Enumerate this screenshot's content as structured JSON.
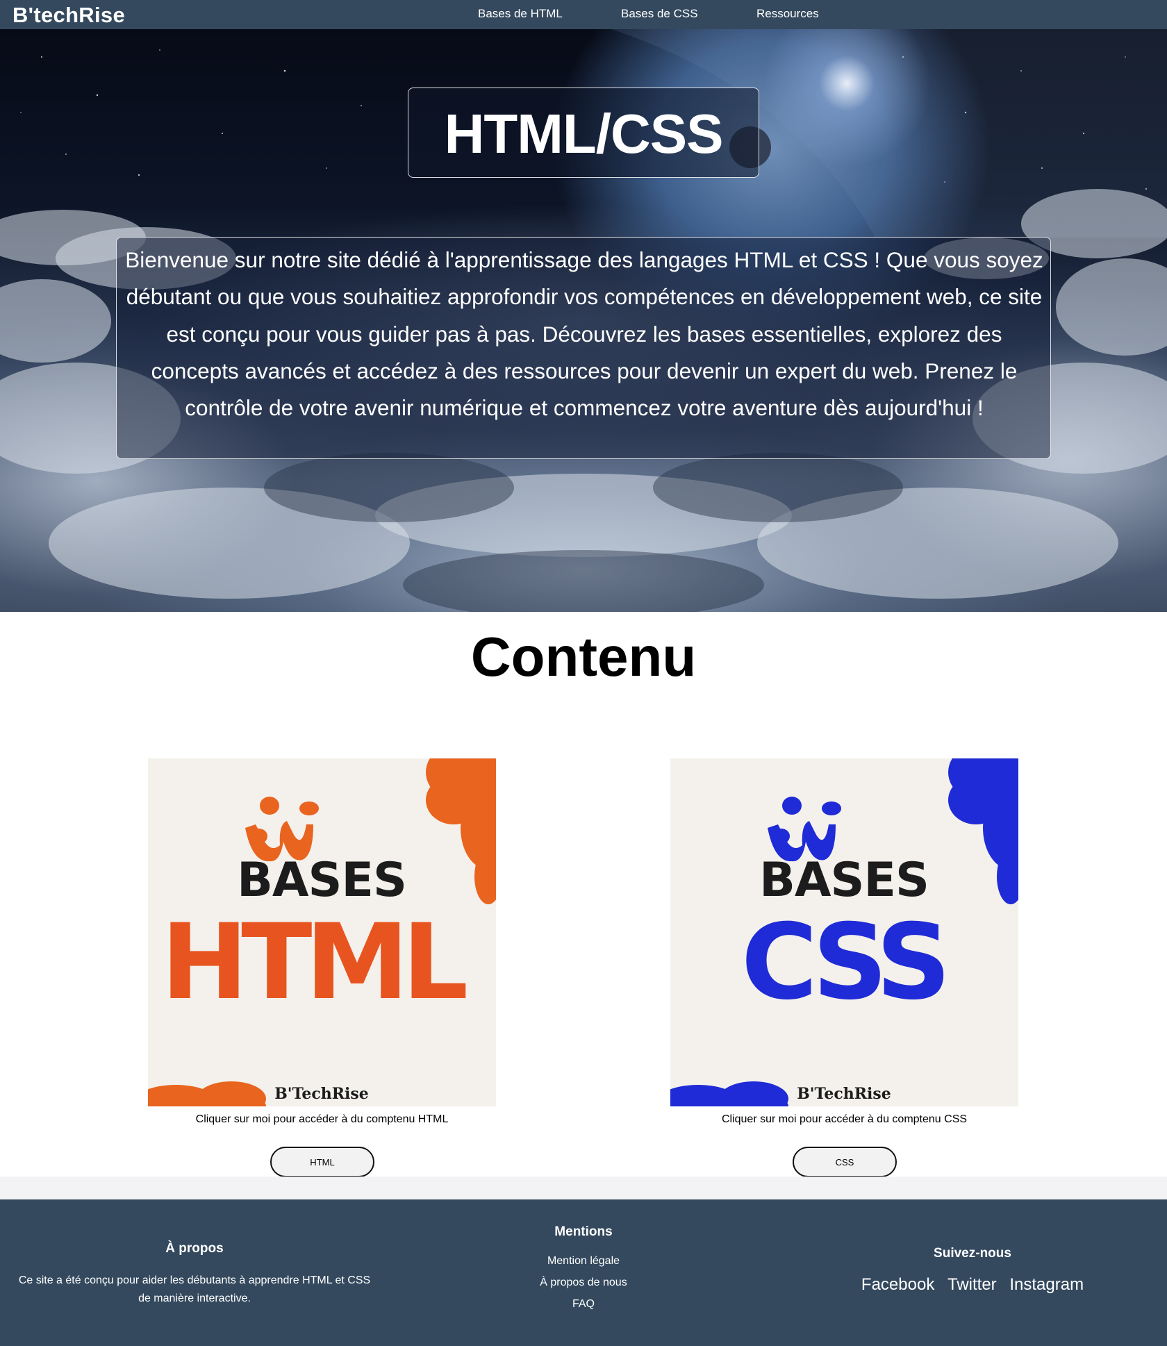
{
  "nav": {
    "logo": "B'techRise",
    "links": [
      "Bases de HTML",
      "Bases de CSS",
      "Ressources"
    ]
  },
  "hero": {
    "title": "HTML/CSS",
    "text": "Bienvenue sur notre site dédié à l'apprentissage des langages HTML et CSS ! Que vous soyez débutant ou que vous souhaitiez approfondir vos compétences en développement web, ce site est conçu pour vous guider pas à pas. Découvrez les bases essentielles, explorez des concepts avancés et accédez à des ressources pour devenir un expert du web. Prenez le contrôle de votre avenir numérique et commencez votre aventure dès aujourd'hui !"
  },
  "content": {
    "title": "Contenu",
    "cards": [
      {
        "img_word1": "BASES",
        "img_word2": "HTML",
        "img_brand": "B'TechRise",
        "accent": "#e8541f",
        "caption": "Cliquer sur moi pour accéder à du comptenu HTML",
        "button": "HTML"
      },
      {
        "img_word1": "BASES",
        "img_word2": "CSS",
        "img_brand": "B'TechRise",
        "accent": "#1f2bd6",
        "caption": "Cliquer sur moi pour accéder à du comptenu CSS",
        "button": "CSS"
      }
    ]
  },
  "footer": {
    "about": {
      "title": "À propos",
      "text": "Ce site a été conçu pour aider les débutants à apprendre HTML et CSS de manière interactive."
    },
    "mentions": {
      "title": "Mentions",
      "links": [
        "Mention légale",
        "À propos de nous",
        "FAQ"
      ]
    },
    "social": {
      "title": "Suivez-nous",
      "links": [
        "Facebook",
        "Twitter",
        "Instagram"
      ]
    }
  },
  "colors": {
    "nav_bg": "#34495e",
    "footer_bg": "#34495e",
    "html_accent": "#e8541f",
    "css_accent": "#1f2bd6"
  }
}
